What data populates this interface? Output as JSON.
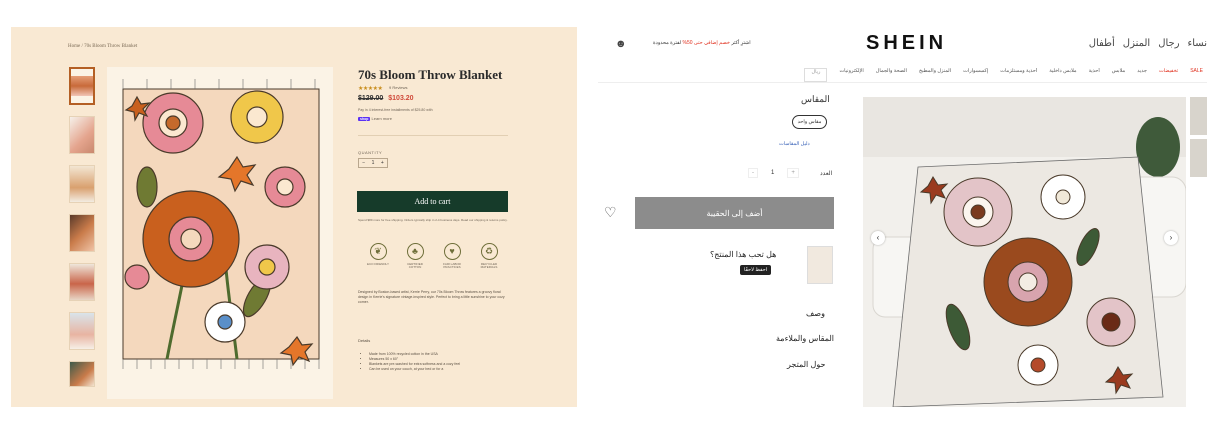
{
  "left": {
    "breadcrumb": "Home / 70s Bloom Throw Blanket",
    "title": "70s Bloom Throw Blanket",
    "rating_stars": "★★★★★",
    "reviews": "9 Reviews",
    "price_old": "$129.00",
    "price_new": "$103.20",
    "pay_in_4": "Pay in 4 interest-free installments of $25.80 with",
    "shop_pay": "shop",
    "learn_more": "Learn more",
    "quantity_label": "QUANTITY",
    "qty_minus": "−",
    "qty_value": "1",
    "qty_plus": "+",
    "add_to_cart": "Add to cart",
    "fine_print": "Spend $89 more for free shipping. Orders typically ship in 2-4 business days. Read our shipping & returns policy.",
    "badges": [
      {
        "icon": "leaf-icon",
        "glyph": "❦",
        "label": "ECO FRIENDLY"
      },
      {
        "icon": "tree-icon",
        "glyph": "♣",
        "label": "CERTIFIED COTTON"
      },
      {
        "icon": "heart-icon",
        "glyph": "♥",
        "label": "FAIR LABOR PRACTICES"
      },
      {
        "icon": "recycle-icon",
        "glyph": "♻",
        "label": "RECYCLED MATERIALS"
      }
    ],
    "description": "Designed by Boston-based artist, Kerrie Perry, our 70s Bloom Throw features a groovy floral design in Kerrie's signature vintage-inspired style. Perfect to bring a little sunshine to your cozy corner.",
    "details_label": "Details",
    "bullets": [
      "Made from 100% recycled cotton in the USA",
      "Measures 50 x 60\"",
      "Blankets are pre-washed for extra softness and a cozy feel",
      "Can be used on your couch, at your bed or for a"
    ]
  },
  "right": {
    "brand": "SHEIN",
    "promo_prefix": "اشترِ أكثر",
    "promo_red": "خصم إضافي حتى 50%",
    "promo_suffix": "لفترة محدودة",
    "top_nav": [
      "أطفال",
      "المنزل",
      "رجال",
      "نساء"
    ],
    "categories": [
      "SALE",
      "تخفيضات",
      "جديد",
      "ملابس",
      "أحذية",
      "ملابس داخلية",
      "أحذية ومستلزمات",
      "إكسسوارات",
      "المنزل والمطبخ",
      "الصحة والجمال",
      "الإلكترونيات"
    ],
    "category_selected": "ريال",
    "size_label": "المقاس",
    "size_value": "مقاس واحد",
    "size_guide": "دليل المقاسات",
    "qty_label": "العدد",
    "qty_minus": "-",
    "qty_value": "1",
    "qty_plus": "+",
    "add_to_bag": "أضف إلى الحقيبة",
    "like_question": "هل تحب هذا المنتج؟",
    "tooltip": "احفظ لاحقًا",
    "section_description": "وصف",
    "section_size_fit": "المقاس والملاءمة",
    "section_about_store": "حول المتجر",
    "arrow_left": "‹",
    "arrow_right": "›"
  }
}
